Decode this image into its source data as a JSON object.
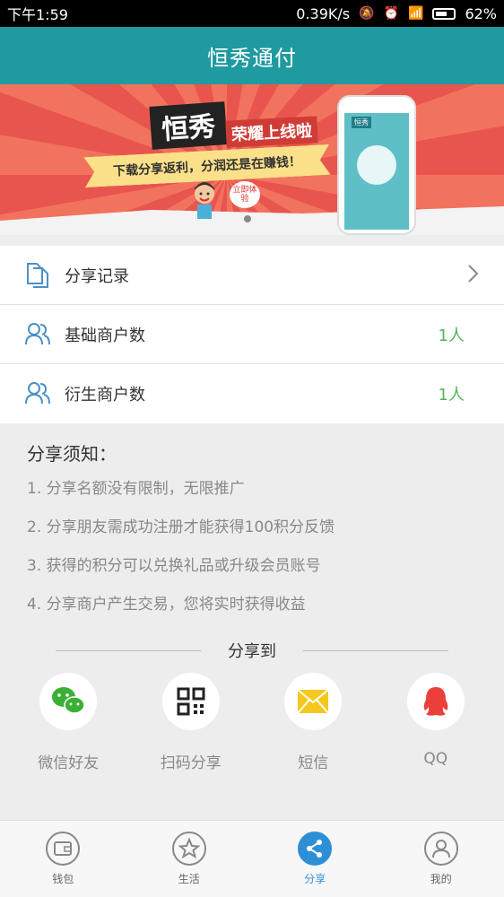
{
  "status": {
    "time": "下午1:59",
    "speed": "0.39K/s",
    "battery": "62%"
  },
  "header": {
    "title": "恒秀通付"
  },
  "banner": {
    "logo": "恒秀",
    "slogan": "荣耀上线啦",
    "ribbon": "下载分享返利，分润还是在赚钱！",
    "bubble": "立即体验",
    "phone_tag": "恒秀"
  },
  "menu": [
    {
      "label": "分享记录",
      "count": "",
      "icon": "document-icon",
      "chevron": true
    },
    {
      "label": "基础商户数",
      "count": "1人",
      "icon": "users-icon"
    },
    {
      "label": "衍生商户数",
      "count": "1人",
      "icon": "users-icon"
    }
  ],
  "notice": {
    "title": "分享须知：",
    "items": [
      "1. 分享名额没有限制，无限推广",
      "2. 分享朋友需成功注册才能获得100积分反馈",
      "3. 获得的积分可以兑换礼品或升级会员账号",
      "4. 分享商户产生交易，您将实时获得收益"
    ]
  },
  "share": {
    "heading": "分享到",
    "targets": [
      {
        "label": "微信好友",
        "icon": "wechat-icon"
      },
      {
        "label": "扫码分享",
        "icon": "qrcode-icon"
      },
      {
        "label": "短信",
        "icon": "envelope-icon"
      },
      {
        "label": "QQ",
        "icon": "qq-icon"
      }
    ]
  },
  "tabs": [
    {
      "label": "钱包",
      "icon": "wallet-icon",
      "active": false
    },
    {
      "label": "生活",
      "icon": "star-icon",
      "active": false
    },
    {
      "label": "分享",
      "icon": "share-icon",
      "active": true
    },
    {
      "label": "我的",
      "icon": "user-icon",
      "active": false
    }
  ],
  "colors": {
    "primary": "#1f9aa0",
    "accent": "#2f8fd6",
    "count": "#57b35c"
  }
}
